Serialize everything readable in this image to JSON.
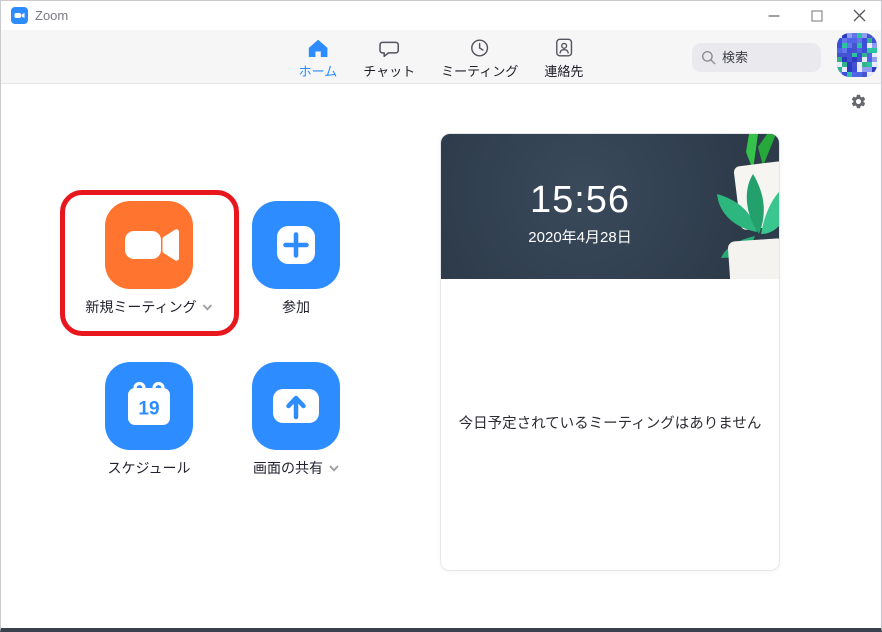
{
  "window": {
    "title": "Zoom",
    "control_icons": [
      "minimize-icon",
      "maximize-icon",
      "close-icon"
    ]
  },
  "nav": {
    "tabs": [
      {
        "label": "ホーム",
        "icon": "home-icon",
        "active": true
      },
      {
        "label": "チャット",
        "icon": "chat-icon",
        "active": false
      },
      {
        "label": "ミーティング",
        "icon": "meetings-clock-icon",
        "active": false
      },
      {
        "label": "連絡先",
        "icon": "contacts-icon",
        "active": false
      }
    ],
    "search_placeholder": "検索"
  },
  "actions": [
    {
      "label": "新規ミーティング",
      "icon": "video-camera-icon",
      "color": "#FF742E",
      "has_dropdown": true,
      "annotated": true
    },
    {
      "label": "参加",
      "icon": "plus-icon",
      "color": "#2D8CFF",
      "has_dropdown": false
    },
    {
      "label": "スケジュール",
      "icon": "calendar-icon",
      "calendar_day": "19",
      "color": "#2D8CFF",
      "has_dropdown": false
    },
    {
      "label": "画面の共有",
      "icon": "share-screen-arrow-icon",
      "color": "#2D8CFF",
      "has_dropdown": true
    }
  ],
  "meeting_panel": {
    "time": "15:56",
    "date": "2020年4月28日",
    "empty_message": "今日予定されているミーティングはありません"
  },
  "colors": {
    "accent_blue": "#2D8CFF",
    "action_orange": "#FF742E",
    "annotation_red": "#E8171E",
    "panel_hero_bg": "#31404F",
    "navbar_bg": "#F6F6F7",
    "window_bottom_edge": "#3A414D"
  }
}
